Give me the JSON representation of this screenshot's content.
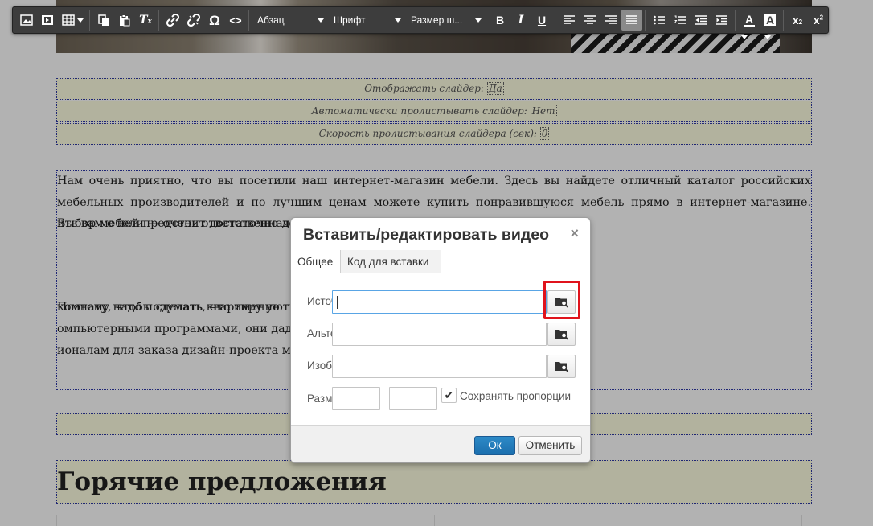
{
  "toolbar": {
    "format_label": "Абзац",
    "font_label": "Шрифт",
    "size_label": "Размер ш...",
    "icons": [
      "image-icon",
      "media-icon",
      "table-icon",
      "copy-icon",
      "paste-icon",
      "clear-format-icon",
      "link-icon",
      "unlink-icon",
      "omega-icon",
      "code-icon",
      "bold-icon",
      "italic-icon",
      "underline-icon",
      "align-left-icon",
      "align-center-icon",
      "align-right-icon",
      "align-justify-icon",
      "bullet-list-icon",
      "numbered-list-icon",
      "outdent-icon",
      "indent-icon",
      "text-color-icon",
      "background-color-icon",
      "subscript-icon",
      "superscript-icon"
    ]
  },
  "content": {
    "settings": [
      {
        "label": "Отображать слайдер:",
        "value": "Да"
      },
      {
        "label": "Автоматически пролистывать слайдер:",
        "value": "Нет"
      },
      {
        "label": "Скорость пролистывания слайдера (сек):",
        "value": "0"
      }
    ],
    "paragraph1_a": "Нам очень приятно, что вы посетили наш интернет-магазин мебели. Здесь вы найдете отличный каталог российских мебельных производителей и по лучшим ценам можете купить понравившуюся мебель прямо в интернет-магазине. Выбор мебели — очень ответственная",
    "paragraph1_b": "ить вам с ней предстоит достаточно долго.",
    "paragraph2_a": "Поэтому надо подумать, что именно",
    "paragraph2_b": "комнату, чтобы сделать квартиру уютной, красивой и удобной. Для эт",
    "paragraph2_c": "омпьютерными программами, они дадут наглядное представление о при",
    "paragraph2_d": "ионалам для заказа дизайн-проекта меблировки.",
    "hot_title": "Горячие предложения"
  },
  "dialog": {
    "title": "Вставить/редактировать видео",
    "close": "×",
    "tabs": [
      {
        "label": "Общее",
        "active": true
      },
      {
        "label": "Код для вставки",
        "active": false
      }
    ],
    "fields": {
      "source_label": "Источник",
      "source_value": "",
      "alt_label": "Альтернативный источник",
      "alt_value": "",
      "poster_label": "Изображение",
      "poster_value": "",
      "size_label": "Размеры",
      "width_value": "",
      "height_value": ""
    },
    "keep_ratio_label": "Сохранять пропорции",
    "keep_ratio_checked": "✔",
    "ok_label": "Ок",
    "cancel_label": "Отменить"
  },
  "colors": {
    "toolbar_bg": "#3d3d3d",
    "settings_bg": "#ffffe3",
    "ok_blue": "#2381c3",
    "highlight_red": "#e0131c"
  }
}
